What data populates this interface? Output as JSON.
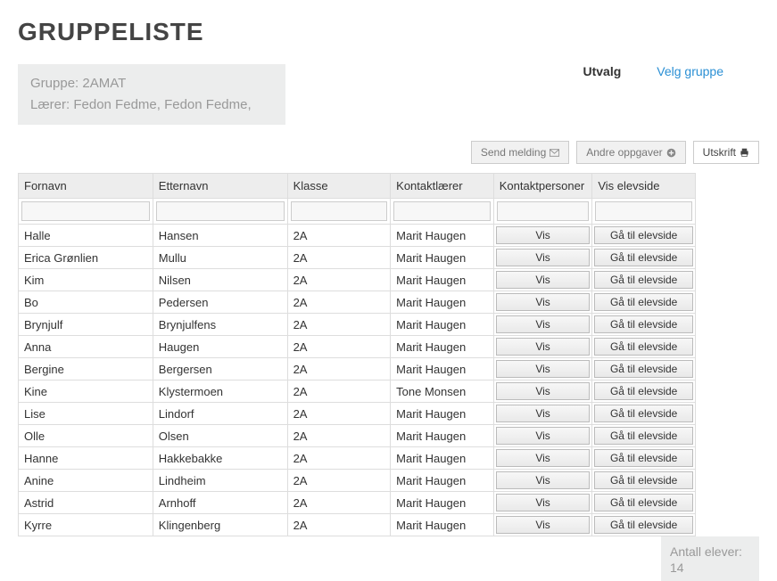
{
  "title": "GRUPPELISTE",
  "groupInfo": {
    "groupLabel": "Gruppe:",
    "groupName": "2AMAT",
    "teacherLabel": "Lærer:",
    "teacherNames": "Fedon Fedme,  Fedon Fedme,"
  },
  "selection": {
    "label": "Utvalg",
    "link": "Velg gruppe"
  },
  "toolbar": {
    "sendMessage": "Send melding",
    "otherTasks": "Andre oppgaver",
    "print": "Utskrift"
  },
  "columns": {
    "fornavn": "Fornavn",
    "etternavn": "Etternavn",
    "klasse": "Klasse",
    "kontaktlarer": "Kontaktlærer",
    "kontaktpersoner": "Kontaktpersoner",
    "visElevside": "Vis elevside"
  },
  "buttons": {
    "vis": "Vis",
    "gaTilElevside": "Gå til elevside"
  },
  "rows": [
    {
      "fornavn": "Halle",
      "etternavn": "Hansen",
      "klasse": "2A",
      "kontaktlarer": "Marit Haugen"
    },
    {
      "fornavn": "Erica Grønlien",
      "etternavn": "Mullu",
      "klasse": "2A",
      "kontaktlarer": "Marit Haugen"
    },
    {
      "fornavn": "Kim",
      "etternavn": "Nilsen",
      "klasse": "2A",
      "kontaktlarer": "Marit Haugen"
    },
    {
      "fornavn": "Bo",
      "etternavn": "Pedersen",
      "klasse": "2A",
      "kontaktlarer": "Marit Haugen"
    },
    {
      "fornavn": "Brynjulf",
      "etternavn": "Brynjulfens",
      "klasse": "2A",
      "kontaktlarer": "Marit Haugen"
    },
    {
      "fornavn": "Anna",
      "etternavn": "Haugen",
      "klasse": "2A",
      "kontaktlarer": "Marit Haugen"
    },
    {
      "fornavn": "Bergine",
      "etternavn": "Bergersen",
      "klasse": "2A",
      "kontaktlarer": "Marit Haugen"
    },
    {
      "fornavn": "Kine",
      "etternavn": "Klystermoen",
      "klasse": "2A",
      "kontaktlarer": "Tone Monsen"
    },
    {
      "fornavn": "Lise",
      "etternavn": "Lindorf",
      "klasse": "2A",
      "kontaktlarer": "Marit Haugen"
    },
    {
      "fornavn": "Olle",
      "etternavn": "Olsen",
      "klasse": "2A",
      "kontaktlarer": "Marit Haugen"
    },
    {
      "fornavn": "Hanne",
      "etternavn": "Hakkebakke",
      "klasse": "2A",
      "kontaktlarer": "Marit Haugen"
    },
    {
      "fornavn": "Anine",
      "etternavn": "Lindheim",
      "klasse": "2A",
      "kontaktlarer": "Marit Haugen"
    },
    {
      "fornavn": "Astrid",
      "etternavn": "Arnhoff",
      "klasse": "2A",
      "kontaktlarer": "Marit Haugen"
    },
    {
      "fornavn": "Kyrre",
      "etternavn": "Klingenberg",
      "klasse": "2A",
      "kontaktlarer": "Marit Haugen"
    }
  ],
  "footer": {
    "label": "Antall elever:",
    "count": "14"
  }
}
